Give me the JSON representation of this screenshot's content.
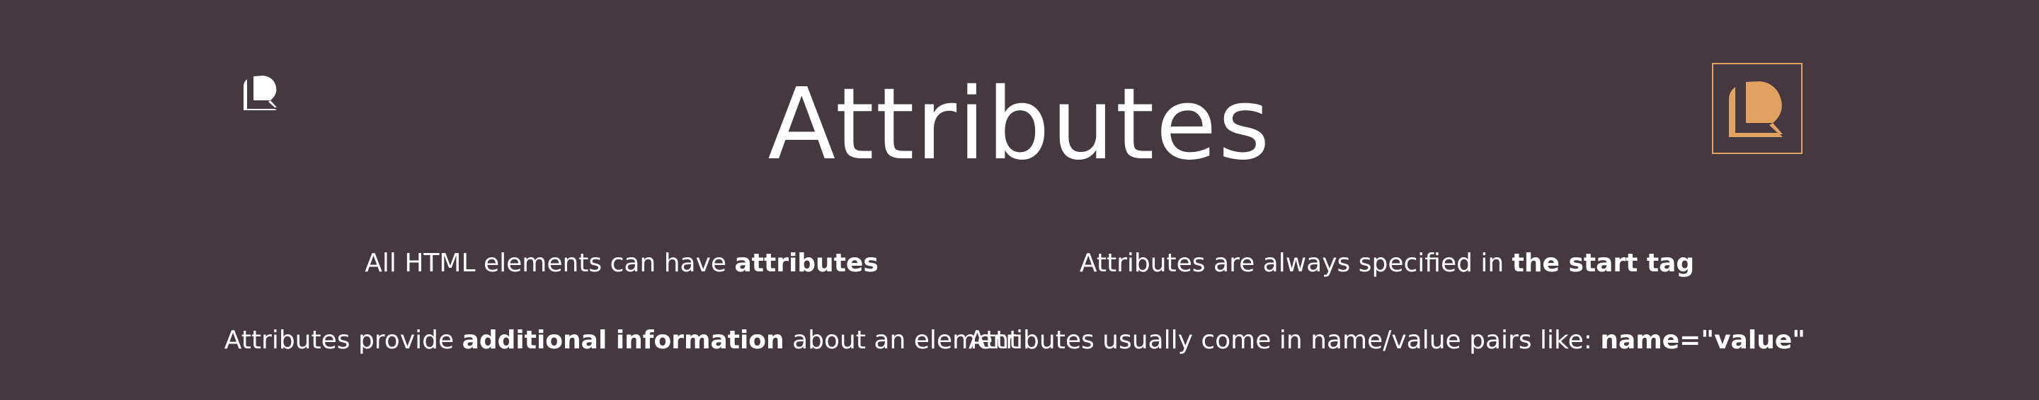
{
  "slide": {
    "title": "Attributes",
    "points": [
      {
        "before": "All HTML elements can have ",
        "bold": "attributes",
        "after": ""
      },
      {
        "before": "Attributes are always specified in ",
        "bold": "the start tag",
        "after": ""
      },
      {
        "before": "Attributes provide ",
        "bold": "additional information",
        "after": " about an element"
      },
      {
        "before": "Attributes usually come in name/value pairs like: ",
        "bold": "name=\"value\"",
        "after": ""
      }
    ]
  },
  "colors": {
    "background": "#453841",
    "accent": "#e0a25e",
    "text": "#ffffff"
  },
  "icons": {
    "top_left": "brand-logo-icon",
    "top_right": "brand-logo-icon"
  }
}
